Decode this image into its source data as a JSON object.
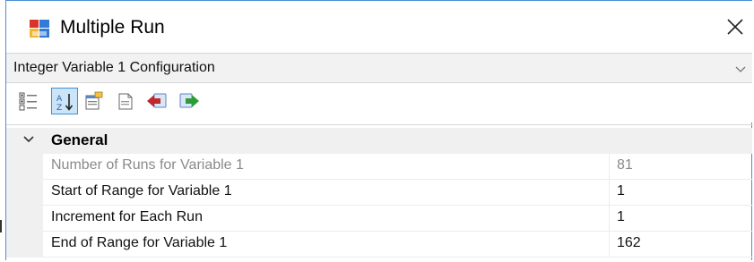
{
  "window": {
    "title": "Multiple Run",
    "app_icon": "window-app-icon",
    "close_icon": "close-icon"
  },
  "selector": {
    "value": "Integer Variable 1 Configuration",
    "arrow_icon": "chevron-down-icon"
  },
  "toolbar": {
    "buttons": [
      {
        "name": "categorized-button",
        "icon": "categorized-icon",
        "active": false
      },
      {
        "name": "alphabetical-button",
        "icon": "sort-alphabetical-icon",
        "active": true
      },
      {
        "name": "property-pages-button",
        "icon": "property-pages-icon",
        "active": false
      },
      {
        "name": "events-button",
        "icon": "document-icon",
        "active": false
      },
      {
        "name": "back-button",
        "icon": "arrow-back-icon",
        "active": false
      },
      {
        "name": "forward-button",
        "icon": "arrow-forward-icon",
        "active": false
      }
    ]
  },
  "grid": {
    "category": "General",
    "properties": [
      {
        "name": "Number of Runs for Variable 1",
        "value": "81",
        "readonly": true
      },
      {
        "name": "Start of Range for Variable 1",
        "value": "1",
        "readonly": false
      },
      {
        "name": "Increment for Each Run",
        "value": "1",
        "readonly": false
      },
      {
        "name": "End of Range for Variable 1",
        "value": "162",
        "readonly": false
      }
    ]
  },
  "colors": {
    "frame_border": "#4a8fd6",
    "category_bg": "#f0f0f0",
    "readonly_text": "#8a8a8a",
    "active_button_bg": "#cce4f7"
  }
}
